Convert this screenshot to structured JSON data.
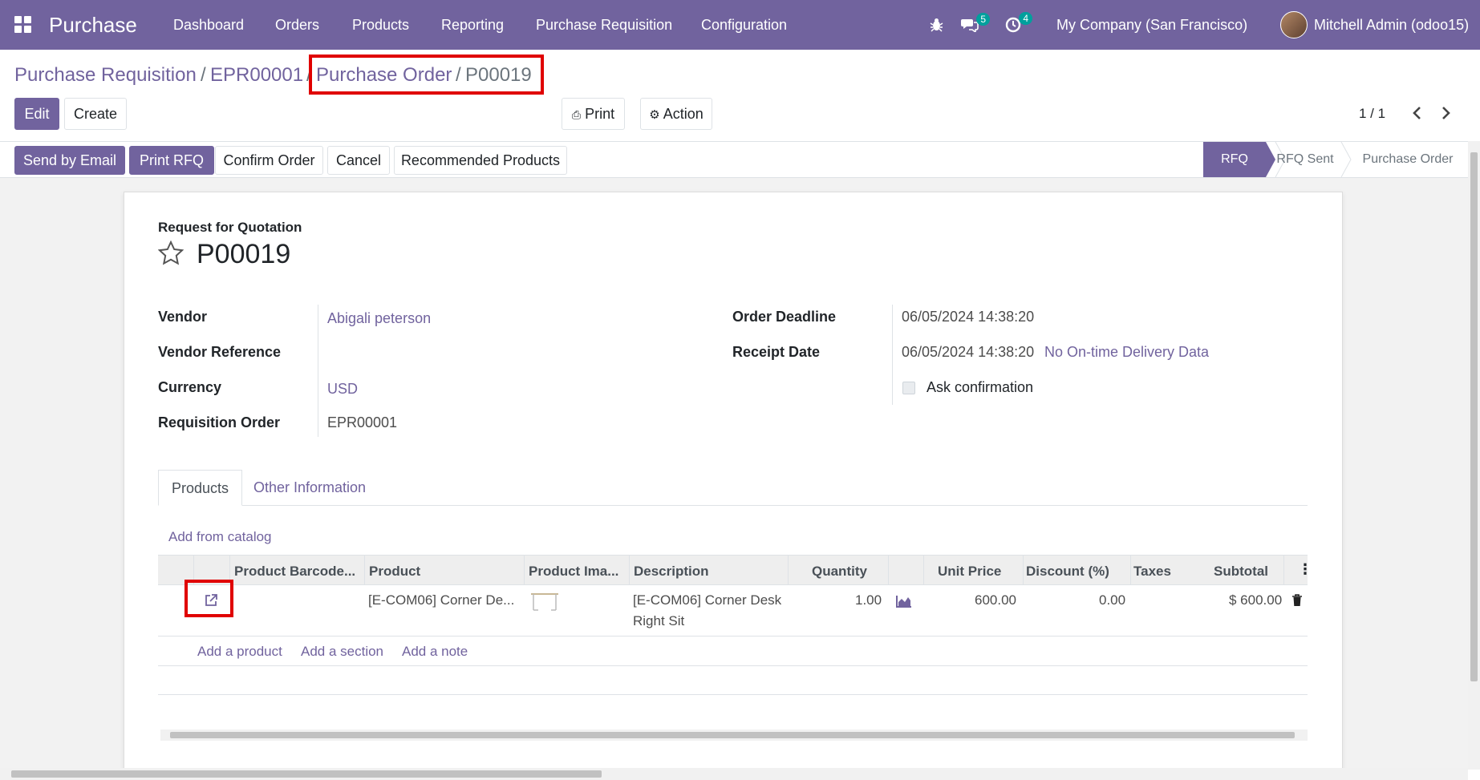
{
  "navbar": {
    "app_name": "Purchase",
    "menu": [
      "Dashboard",
      "Orders",
      "Products",
      "Reporting",
      "Purchase Requisition",
      "Configuration"
    ],
    "messages_count": "5",
    "activities_count": "4",
    "company": "My Company (San Francisco)",
    "user": "Mitchell Admin (odoo15)"
  },
  "breadcrumb": {
    "items": [
      "Purchase Requisition",
      "EPR00001",
      "Purchase Order"
    ],
    "current": "P00019",
    "sep": "/"
  },
  "toolbar": {
    "edit": "Edit",
    "create": "Create",
    "print": "Print",
    "action": "Action",
    "pager": "1 / 1"
  },
  "statusbar": {
    "buttons": [
      "Send by Email",
      "Print RFQ",
      "Confirm Order",
      "Cancel",
      "Recommended Products"
    ],
    "stages": [
      "RFQ",
      "RFQ Sent",
      "Purchase Order"
    ],
    "active_stage": "RFQ"
  },
  "form": {
    "subtitle": "Request for Quotation",
    "name": "P00019",
    "left": [
      {
        "label": "Vendor",
        "value": "Abigali peterson",
        "link": true
      },
      {
        "label": "Vendor Reference",
        "value": "",
        "link": false
      },
      {
        "label": "Currency",
        "value": "USD",
        "link": true
      },
      {
        "label": "Requisition Order",
        "value": "EPR00001",
        "link": false
      }
    ],
    "order_deadline_label": "Order Deadline",
    "order_deadline": "06/05/2024 14:38:20",
    "receipt_date_label": "Receipt Date",
    "receipt_date": "06/05/2024 14:38:20",
    "on_time_link": "No On-time Delivery Data",
    "ask_confirmation": "Ask confirmation"
  },
  "tabs": [
    "Products",
    "Other Information"
  ],
  "lines": {
    "add_from_catalog": "Add from catalog",
    "columns": [
      "Product Barcode...",
      "Product",
      "Product Ima...",
      "Description",
      "Quantity",
      "Unit Price",
      "Discount (%)",
      "Taxes",
      "Subtotal"
    ],
    "rows": [
      {
        "product": "[E-COM06] Corner De...",
        "description_1": "[E-COM06] Corner Desk",
        "description_2": "Right Sit",
        "quantity": "1.00",
        "unit_price": "600.00",
        "discount": "0.00",
        "taxes": "",
        "subtotal": "$ 600.00"
      }
    ],
    "add_product": "Add a product",
    "add_section": "Add a section",
    "add_note": "Add a note"
  },
  "colors": {
    "primary": "#71639e",
    "highlight": "#e00000",
    "badge": "#00a09d"
  }
}
